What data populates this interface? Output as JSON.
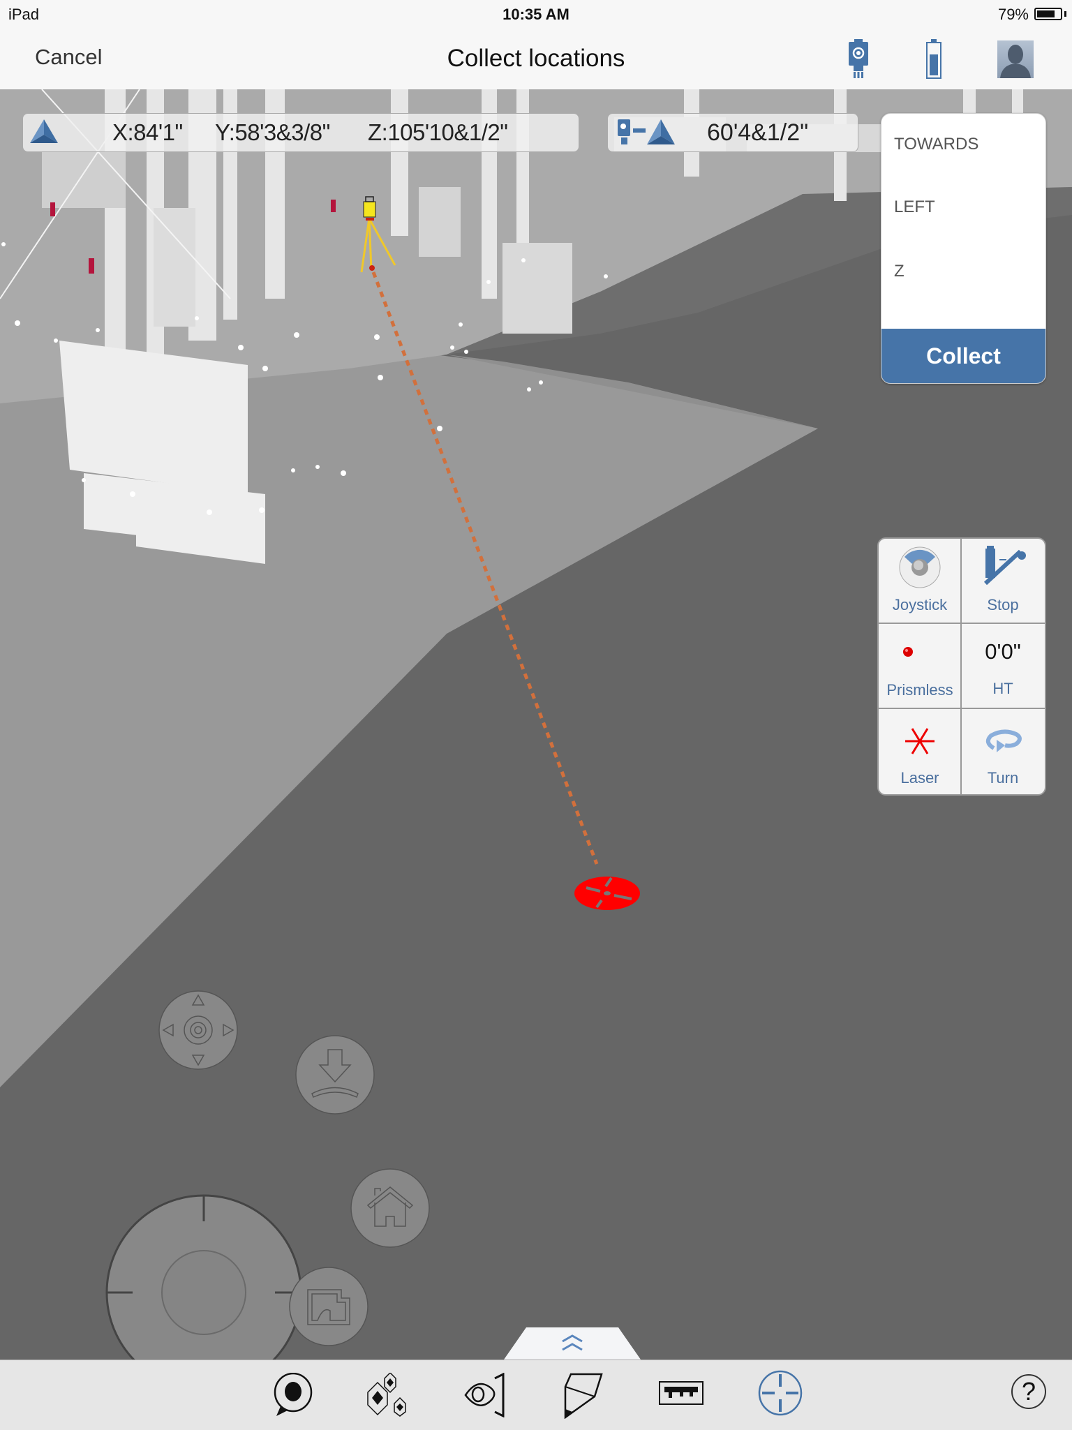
{
  "status_bar": {
    "device": "iPad",
    "time": "10:35 AM",
    "battery_percent": "79%",
    "battery_level": 0.79
  },
  "nav": {
    "cancel_label": "Cancel",
    "title": "Collect locations",
    "icons": [
      "instrument-icon",
      "battery-level-icon",
      "user-profile-icon"
    ]
  },
  "coordinates": {
    "x": "X:84'1\"",
    "y": "Y:58'3&3/8\"",
    "z": "Z:105'10&1/2\""
  },
  "distance": {
    "value": "60'4&1/2\""
  },
  "collect_panel": {
    "fields": [
      "TOWARDS",
      "LEFT",
      "Z"
    ],
    "collect_label": "Collect"
  },
  "tools": {
    "joystick": "Joystick",
    "stop": "Stop",
    "prismless": "Prismless",
    "ht_value": "0'0\"",
    "ht_label": "HT",
    "laser": "Laser",
    "turn": "Turn"
  },
  "colors": {
    "accent": "#4674a8",
    "target": "#ff0000",
    "laser_line": "#d2703c",
    "instrument": "#f5e61e"
  },
  "toolbar": {
    "items": [
      "location-pin-icon",
      "layers-icon",
      "view-icon",
      "markup-icon",
      "measure-icon",
      "stakeout-crosshair-icon"
    ],
    "active": "stakeout-crosshair-icon",
    "help": "?"
  }
}
